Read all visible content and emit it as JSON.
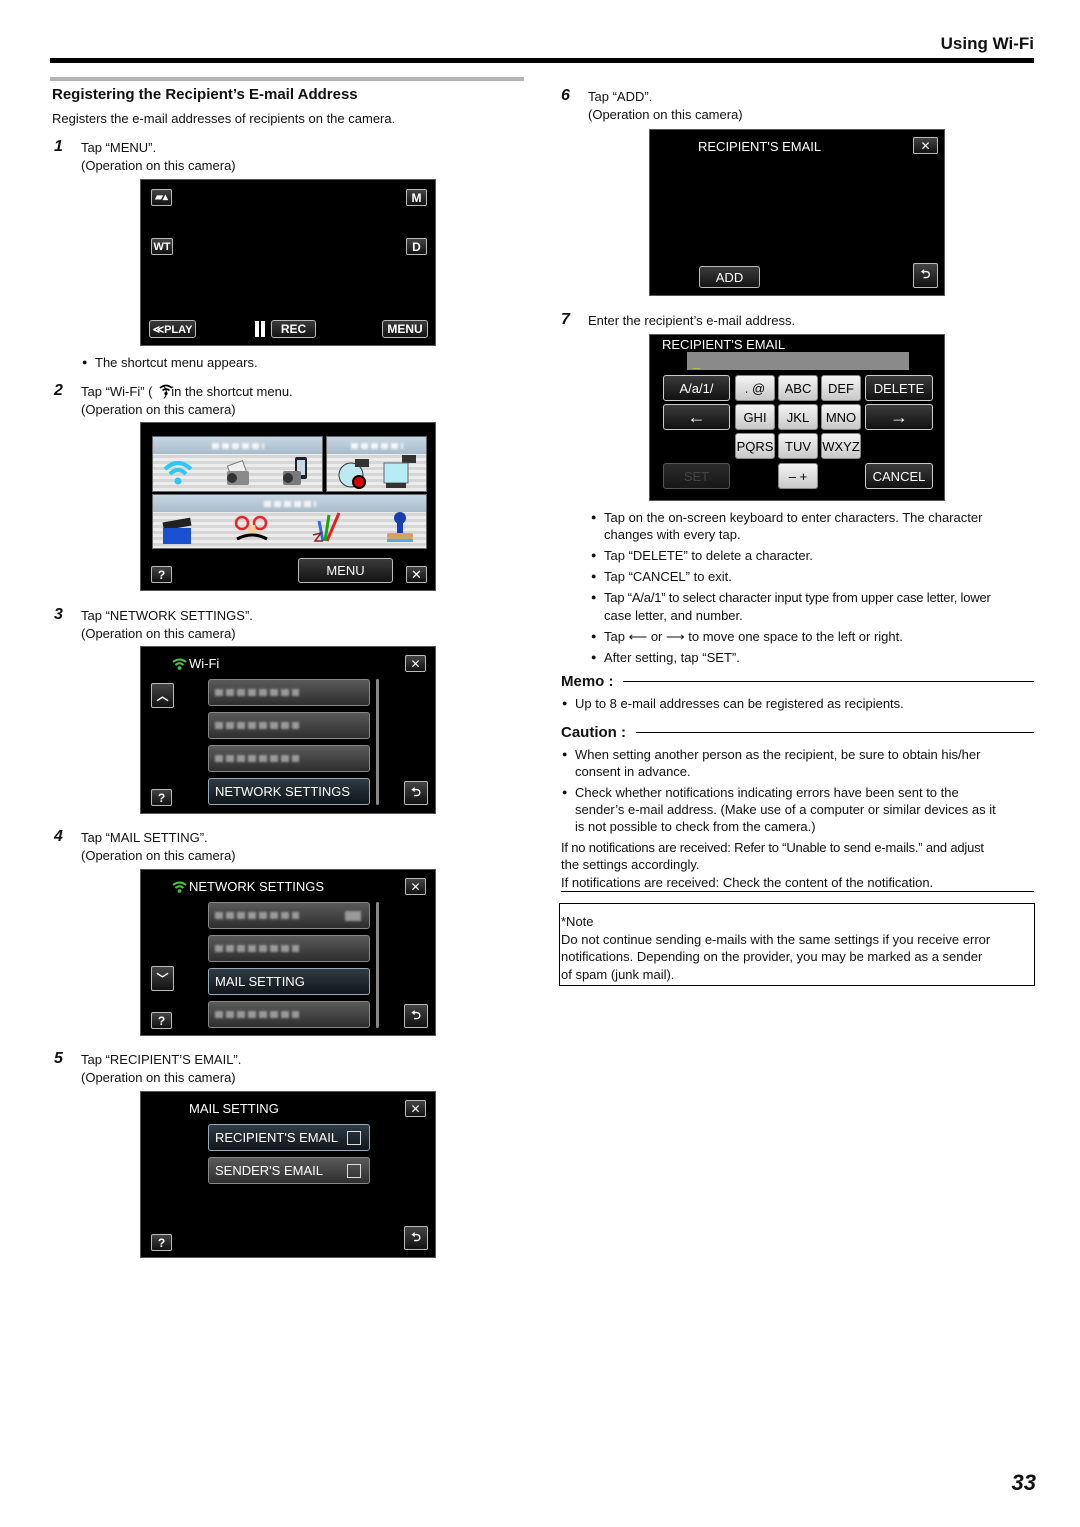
{
  "header": {
    "title": "Using Wi-Fi"
  },
  "section": {
    "title": "Registering the Recipient’s E-mail Address",
    "intro": "Registers the e-mail addresses of recipients on the camera."
  },
  "steps": [
    {
      "num": "1",
      "text": "Tap “MENU”.",
      "sub": "(Operation on this camera)"
    },
    {
      "num": "2",
      "text": "Tap “Wi-Fi” (   ) in the shortcut menu.",
      "sub": "(Operation on this camera)",
      "bullet_before": "The shortcut menu appears."
    },
    {
      "num": "3",
      "text": "Tap “NETWORK SETTINGS”.",
      "sub": "(Operation on this camera)"
    },
    {
      "num": "4",
      "text": "Tap “MAIL SETTING”.",
      "sub": "(Operation on this camera)"
    },
    {
      "num": "5",
      "text": "Tap “RECIPIENT’S EMAIL”.",
      "sub": "(Operation on this camera)"
    },
    {
      "num": "6",
      "text": "Tap “ADD”.",
      "sub": "(Operation on this camera)"
    },
    {
      "num": "7",
      "text": "Enter the recipient’s e-mail address."
    }
  ],
  "screen1": {
    "icon_movie": "movie-camera-icon",
    "btn_m": "M",
    "btn_wt": "WT",
    "btn_d": "D",
    "play": "≪PLAY",
    "rec": "REC",
    "menu": "MENU"
  },
  "screen2": {
    "menu": "MENU",
    "help": "?",
    "close": "✕",
    "panels": [
      "wifi-functions",
      "settings",
      "effects"
    ]
  },
  "screen3": {
    "title": "Wi-Fi",
    "highlight_item": "NETWORK SETTINGS",
    "help": "?",
    "close": "✕"
  },
  "screen4": {
    "title": "NETWORK SETTINGS",
    "highlight_item": "MAIL SETTING",
    "help": "?",
    "close": "✕"
  },
  "screen5": {
    "title": "MAIL SETTING",
    "items": [
      "RECIPIENT'S EMAIL",
      "SENDER'S EMAIL"
    ],
    "help": "?",
    "close": "✕"
  },
  "screen6": {
    "title": "RECIPIENT'S EMAIL",
    "add": "ADD",
    "close": "✕"
  },
  "screen7": {
    "title": "RECIPIENT'S EMAIL",
    "input_value": "_",
    "keys": {
      "mode": "A/a/1/",
      "punct": ". @",
      "abc": "ABC",
      "def": "DEF",
      "delete": "DELETE",
      "left": "←",
      "ghi": "GHI",
      "jkl": "JKL",
      "mno": "MNO",
      "right": "→",
      "pqrs": "PQRS",
      "tuv": "TUV",
      "wxyz": "WXYZ",
      "set": "SET",
      "minus_plus": "– +",
      "cancel": "CANCEL"
    }
  },
  "step7_bullets": [
    "Tap on the on-screen keyboard to enter characters. The character",
    "changes with every tap.",
    "Tap “DELETE” to delete a character.",
    "Tap “CANCEL” to exit.",
    "Tap “A/a/1” to select character input type from upper case letter, lower",
    "case letter, and number.",
    "Tap ⟵ or ⟶ to move one space to the left or right.",
    "After setting, tap “SET”."
  ],
  "memo": {
    "heading": "Memo :",
    "bullets": [
      "Up to 8 e-mail addresses can be registered as recipients."
    ]
  },
  "caution": {
    "heading": "Caution :",
    "lines": [
      "When setting another person as the recipient, be sure to obtain his/her",
      "consent in advance.",
      "Check whether notifications indicating errors have been sent to the",
      "sender’s e-mail address. (Make use of a computer or similar devices as it",
      "is not possible to check from the camera.)",
      "If no notifications are received: Refer to “Unable to send e-mails.” and adjust",
      "the settings accordingly.",
      "If notifications are received: Check the content of the notification."
    ]
  },
  "note": {
    "label": "*Note",
    "lines": [
      "Do not continue sending e-mails with the same settings if you receive error",
      "notifications. Depending on the provider, you may be marked as a sender",
      "of spam (junk mail)."
    ]
  },
  "page_number": "33"
}
